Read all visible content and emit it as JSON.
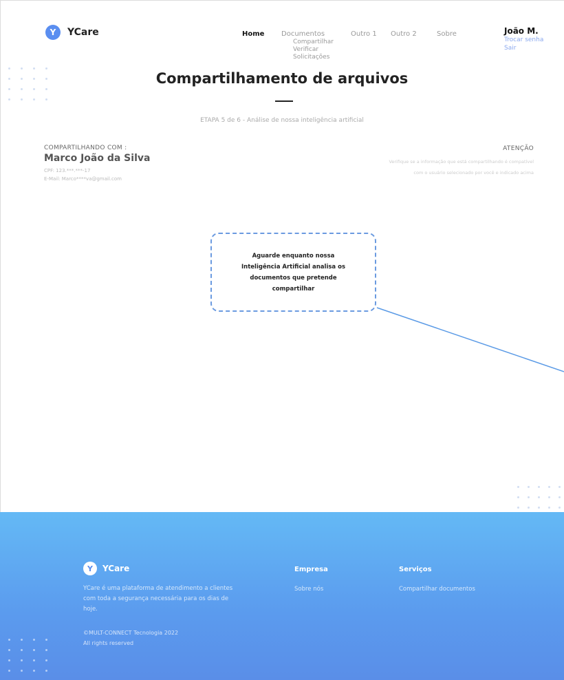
{
  "header": {
    "logo_letter": "Y",
    "logo_text": "YCare",
    "nav": {
      "home": "Home",
      "documentos": "Documentos",
      "documentos_sub": [
        "Compartilhar",
        "Verificar",
        "Solicitações"
      ],
      "outro1": "Outro 1",
      "outro2": "Outro 2",
      "sobre": "Sobre"
    },
    "user": {
      "name": "João M.",
      "change_password": "Trocar senha",
      "logout": "Sair"
    }
  },
  "main": {
    "title": "Compartilhamento de arquivos",
    "step": "ETAPA 5 de 6 - Análise de nossa inteligência artificial",
    "sharing": {
      "label": "COMPARTILHANDO COM :",
      "name": "Marco João da Silva",
      "cpf": "CPF: 123.***.***-17",
      "email": "E-Mail: Marco****va@gmail.com"
    },
    "attention": {
      "title": "ATENÇÃO",
      "line1": "Verifique se a informação que está compartilhando é compatível",
      "line2": "com o usuário selecionado por você e indicado acima"
    },
    "wait_message": {
      "line1": "Aguarde enquanto nossa",
      "line2": "Inteligência Artificial analisa os",
      "line3": "documentos que pretende compartilhar"
    }
  },
  "footer": {
    "logo_letter": "Y",
    "logo_text": "YCare",
    "description": "YCare é uma plataforma de atendimento a clientes com toda a segurança necessária para os dias de hoje.",
    "copyright": "©MULT-CONNECT Tecnologia 2022",
    "rights": "All rights reserved",
    "empresa_title": "Empresa",
    "empresa_link": "Sobre nós",
    "servicos_title": "Serviços",
    "servicos_link": "Compartilhar documentos"
  },
  "colors": {
    "accent": "#5a8ef0",
    "dashed_border": "#6a9ae0",
    "footer_top": "#64b9f5",
    "footer_bottom": "#5a8ee8",
    "link": "#8aa8ee"
  },
  "icons": {
    "logo": "ycare-logo-icon"
  }
}
